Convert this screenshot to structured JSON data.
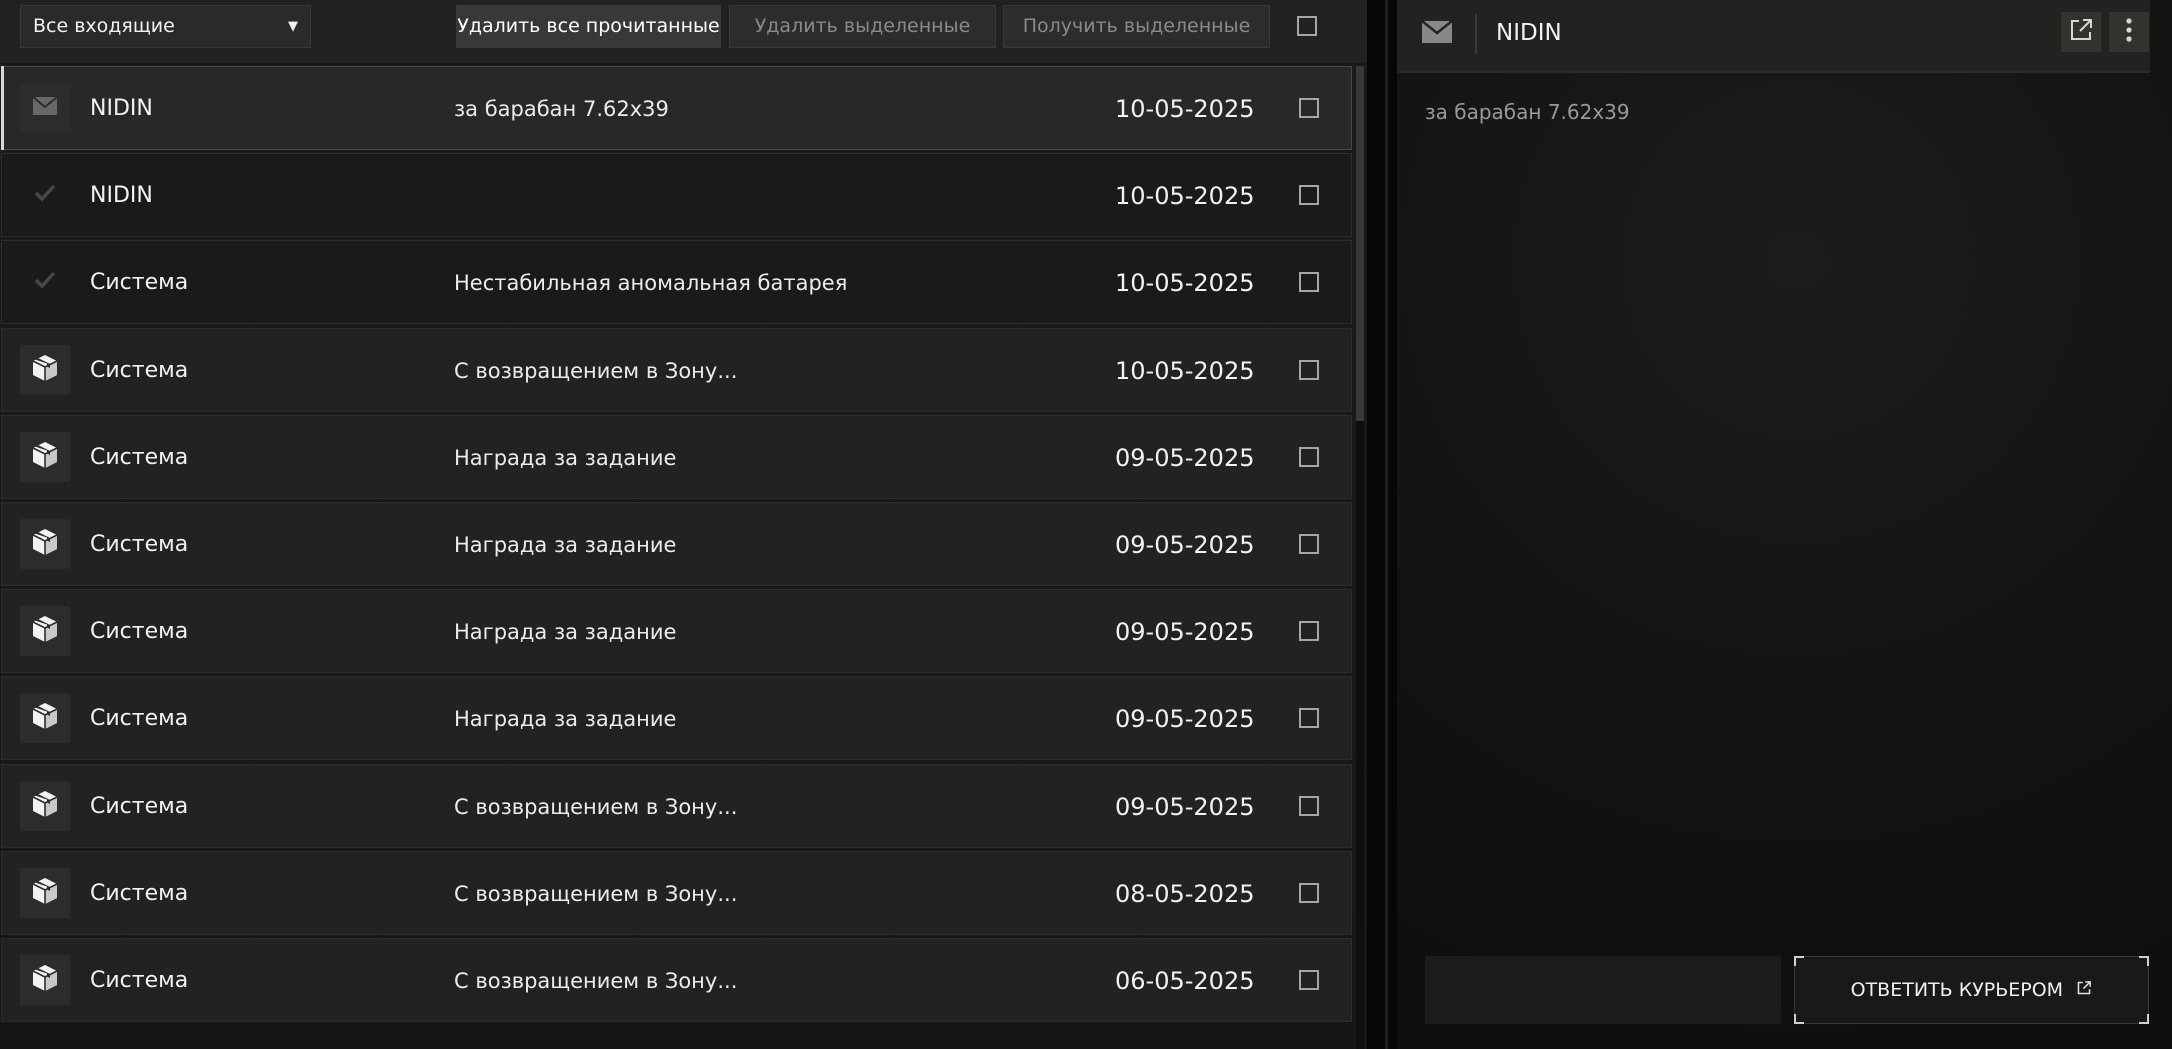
{
  "toolbar": {
    "filter_value": "Все входящие",
    "delete_read_label": "Удалить все прочитанные",
    "delete_selected_label": "Удалить выделенные",
    "receive_selected_label": "Получить выделенные"
  },
  "messages": [
    {
      "icon": "envelope-icon",
      "sender": "NIDIN",
      "subject": "за барабан 7.62x39",
      "date": "10-05-2025",
      "state": "selected"
    },
    {
      "icon": "check-icon",
      "sender": "NIDIN",
      "subject": "",
      "date": "10-05-2025",
      "state": "read"
    },
    {
      "icon": "check-icon",
      "sender": "Система",
      "subject": "Нестабильная аномальная батарея",
      "date": "10-05-2025",
      "state": "read"
    },
    {
      "icon": "package-icon",
      "sender": "Система",
      "subject": "С возвращением в Зону...",
      "date": "10-05-2025",
      "state": "unread"
    },
    {
      "icon": "package-icon",
      "sender": "Система",
      "subject": "Награда за задание",
      "date": "09-05-2025",
      "state": "unread"
    },
    {
      "icon": "package-icon",
      "sender": "Система",
      "subject": "Награда за задание",
      "date": "09-05-2025",
      "state": "unread"
    },
    {
      "icon": "package-icon",
      "sender": "Система",
      "subject": "Награда за задание",
      "date": "09-05-2025",
      "state": "unread"
    },
    {
      "icon": "package-icon",
      "sender": "Система",
      "subject": "Награда за задание",
      "date": "09-05-2025",
      "state": "unread"
    },
    {
      "icon": "package-icon",
      "sender": "Система",
      "subject": "С возвращением в Зону...",
      "date": "09-05-2025",
      "state": "unread"
    },
    {
      "icon": "package-icon",
      "sender": "Система",
      "subject": "С возвращением в Зону...",
      "date": "08-05-2025",
      "state": "unread"
    },
    {
      "icon": "package-icon",
      "sender": "Система",
      "subject": "С возвращением в Зону...",
      "date": "06-05-2025",
      "state": "unread"
    }
  ],
  "reader": {
    "sender": "NIDIN",
    "body": "за барабан 7.62x39",
    "reply_label": "ОТВЕТИТЬ КУРЬЕРОМ"
  }
}
